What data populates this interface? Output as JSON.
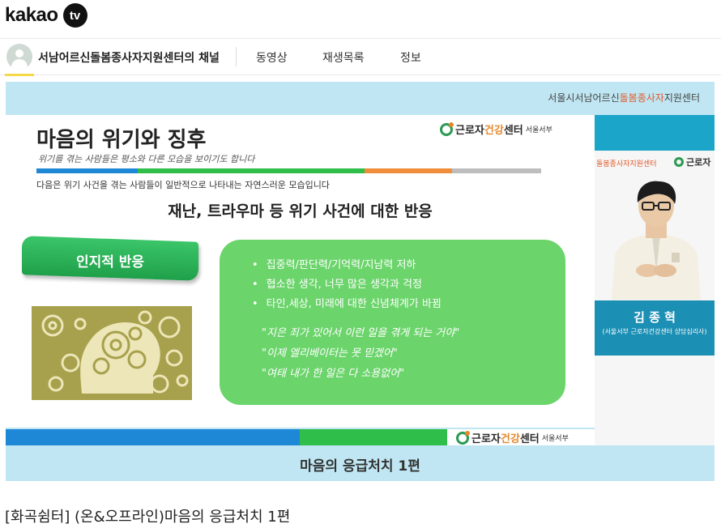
{
  "header": {
    "logo_text": "kakao",
    "logo_badge": "tv"
  },
  "channel": {
    "name": "서남어르신돌봄종사자지원센터의 채널",
    "tabs": [
      {
        "label": "동영상"
      },
      {
        "label": "재생목록"
      },
      {
        "label": "정보"
      }
    ]
  },
  "player": {
    "strip_text_pre": "서울시서남어르신",
    "strip_text_highlight": "돌봄종사자",
    "strip_text_post": "지원센터",
    "slide": {
      "title": "마음의 위기와 징후",
      "subtitle": "위기를 겪는 사람들은 평소와 다른 모습을 보이기도 합니다",
      "description": "다음은 위기 사건을 겪는 사람들이 일반적으로 나타내는 자연스러운 모습입니다",
      "heading": "재난, 트라우마 등 위기 사건에 대한 반응",
      "category_label": "인지적 반응",
      "bullets": [
        "집중력/판단력/기억력/지남력 저하",
        "협소한 생각, 너무 많은 생각과 걱정",
        "타인,세상, 미래에 대한 신념체계가 바뀜"
      ],
      "quotes": [
        "\"지은 죄가 있어서 이런 일을 겪게 되는 거야\"",
        "\"이제 엘리베이터는 못 믿겠어\"",
        "\"여태 내가 한 일은 다 소용없어\""
      ]
    },
    "badge": {
      "pre": "근로자",
      "highlight": "건강",
      "post": "센터",
      "region": "서울서부"
    },
    "speaker": {
      "org_left": "돌봄종사자지원센터",
      "org_right": "근로자",
      "name": "김 종 혁",
      "title": "(서울서부 근로자건강센터 상담심리사)"
    },
    "caption": "마음의 응급처치 1편"
  },
  "video": {
    "title": "[화곡쉼터] (온&오프라인)마음의 응급처치 1편"
  },
  "colors": {
    "bar_blue": "#1e87d6",
    "bar_green": "#2fbe4a",
    "bar_orange": "#f08c3a",
    "bar_gray": "#bdbdbd",
    "panel_green": "#6bd46b",
    "accent_yellow": "#f6d84b"
  }
}
